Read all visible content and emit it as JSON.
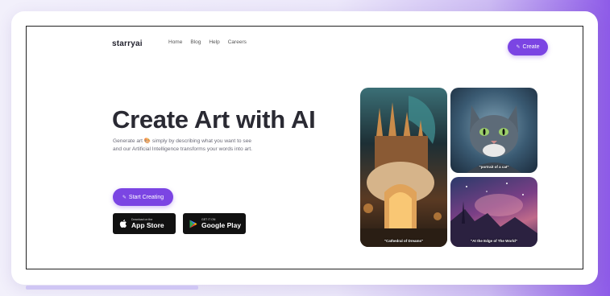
{
  "header": {
    "logo": "starryai",
    "nav": [
      "Home",
      "Blog",
      "Help",
      "Careers"
    ],
    "create_label": "Create"
  },
  "hero": {
    "title": "Create Art with AI",
    "subtitle_line1": "Generate art 🎨 simply by describing what you want to see",
    "subtitle_line2": "and our Artificial Intelligence transforms your words into art.",
    "start_label": "Start Creating"
  },
  "stores": {
    "app_small": "Download on the",
    "app_big": "App Store",
    "play_small": "GET IT ON",
    "play_big": "Google Play"
  },
  "gallery": {
    "cathedral_caption": "\"Cathedral of Dreams\"",
    "cat_caption": "\"portrait of a cat\"",
    "cosmos_caption": "\"At the Edge of The World\""
  },
  "colors": {
    "accent": "#7b45e3",
    "store_bg": "#111111"
  },
  "icons": [
    "pencil-icon",
    "apple-icon",
    "google-play-icon"
  ]
}
